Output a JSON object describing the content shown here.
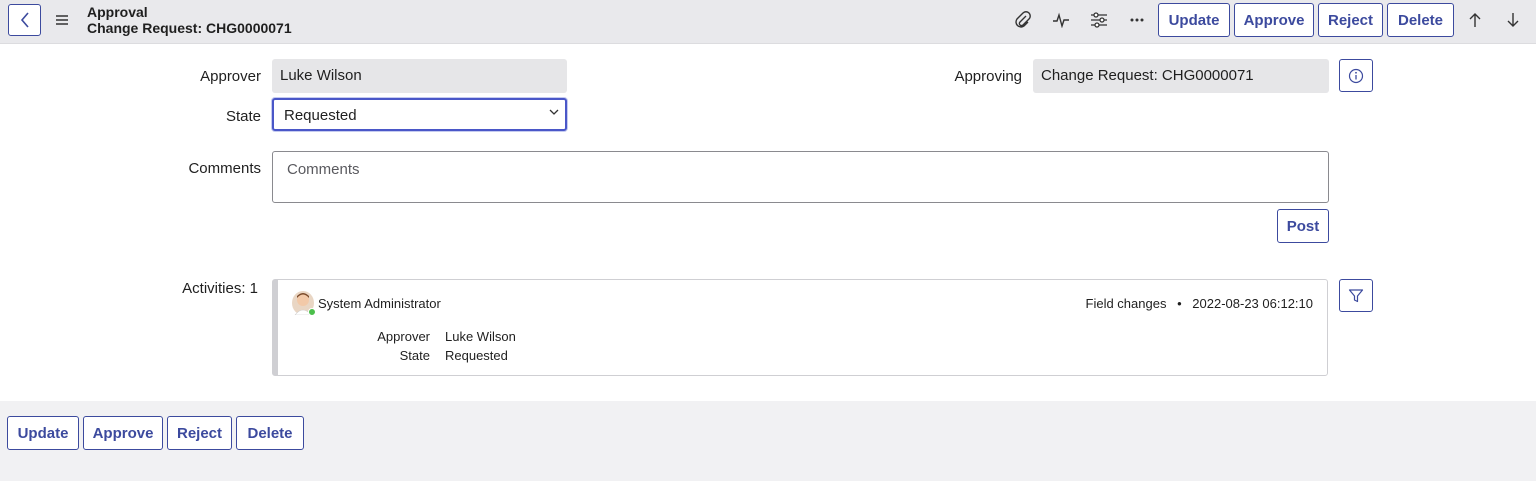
{
  "header": {
    "title_line1": "Approval",
    "title_line2": "Change Request: CHG0000071",
    "icons": [
      "back-icon",
      "menu-icon",
      "paperclip-icon",
      "activity-icon",
      "settings-sliders-icon",
      "more-icon",
      "arrow-up-icon",
      "arrow-down-icon"
    ],
    "buttons": {
      "update": "Update",
      "approve": "Approve",
      "reject": "Reject",
      "delete": "Delete"
    }
  },
  "form": {
    "approver": {
      "label": "Approver",
      "value": "Luke Wilson"
    },
    "state": {
      "label": "State",
      "value": "Requested"
    },
    "approving": {
      "label": "Approving",
      "value": "Change Request: CHG0000071"
    },
    "comments": {
      "label": "Comments",
      "placeholder": "Comments"
    },
    "post_label": "Post"
  },
  "activities": {
    "label": "Activities: 1",
    "entries": [
      {
        "user": "System Administrator",
        "type": "Field changes",
        "separator": "•",
        "timestamp": "2022-08-23 06:12:10",
        "changes": [
          {
            "field": "Approver",
            "value": "Luke Wilson"
          },
          {
            "field": "State",
            "value": "Requested"
          }
        ]
      }
    ]
  },
  "footer": {
    "buttons": {
      "update": "Update",
      "approve": "Approve",
      "reject": "Reject",
      "delete": "Delete"
    }
  },
  "colors": {
    "accent": "#3c4a9e",
    "focus": "#4a57c8",
    "readonly_bg": "#e6e6e8",
    "presence": "#4bbf4b"
  }
}
